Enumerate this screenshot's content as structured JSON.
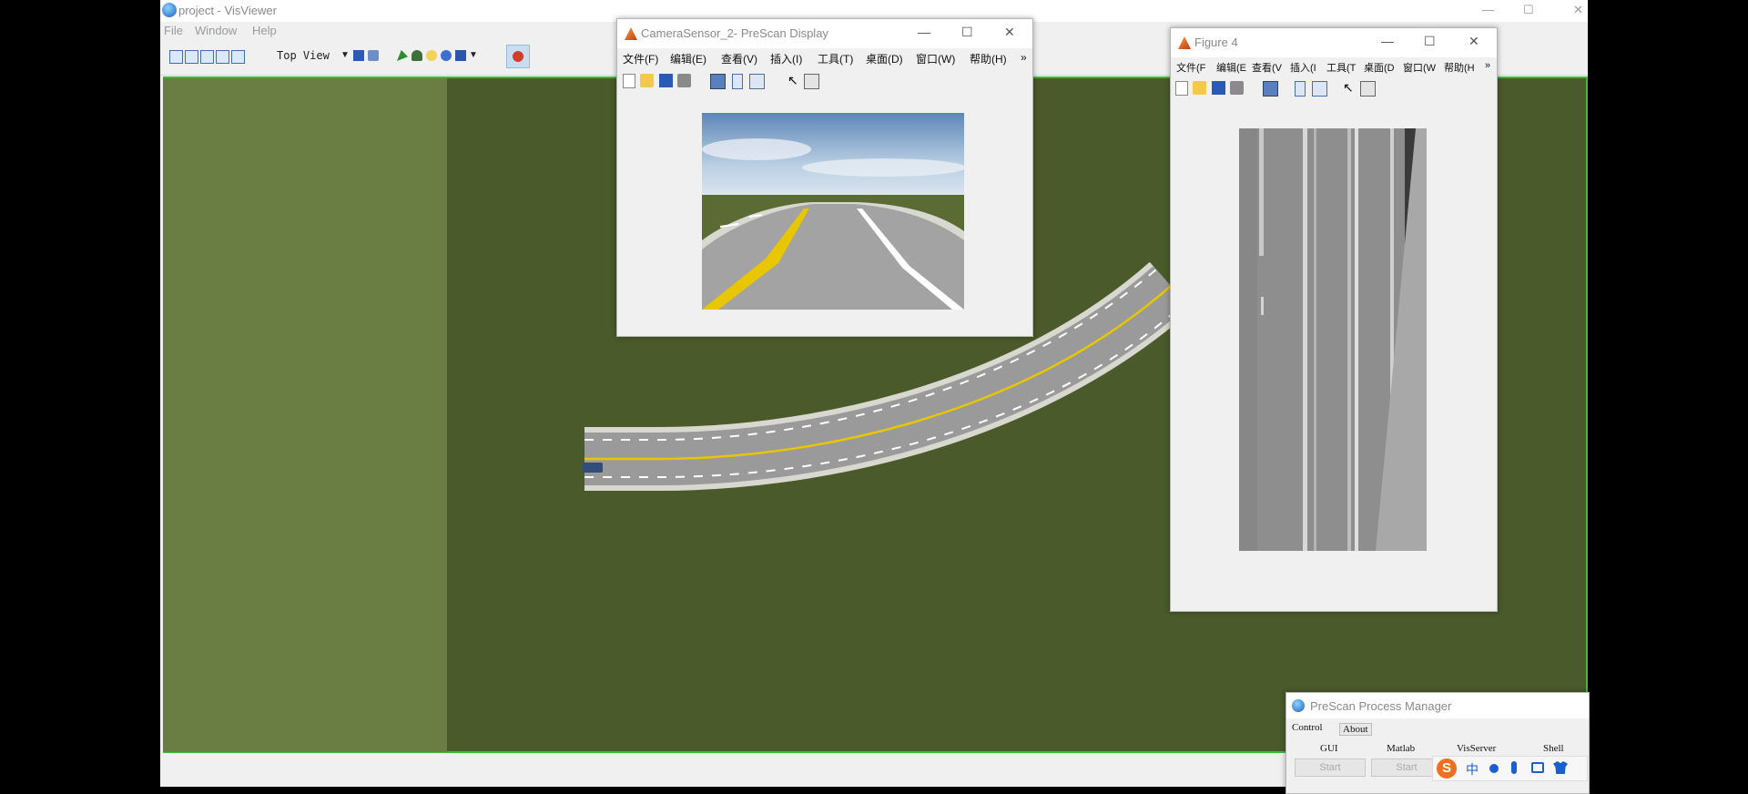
{
  "visviewer": {
    "title": "project - VisViewer",
    "menu": [
      "File",
      "Window",
      "Help"
    ],
    "view_mode": "Top View",
    "window_controls": [
      "—",
      "☐",
      "✕"
    ]
  },
  "camera_window": {
    "title": "CameraSensor_2- PreScan Display",
    "menu": [
      "文件(F)",
      "编辑(E)",
      "查看(V)",
      "插入(I)",
      "工具(T)",
      "桌面(D)",
      "窗口(W)",
      "帮助(H)"
    ],
    "overflow": "»",
    "controls": [
      "—",
      "☐",
      "✕"
    ]
  },
  "figure_window": {
    "title": "Figure 4",
    "menu": [
      "文件(F",
      "编辑(E",
      "查看(V",
      "插入(I",
      "工具(T",
      "桌面(D",
      "窗口(W",
      "帮助(H"
    ],
    "overflow": "»",
    "controls": [
      "—",
      "☐",
      "✕"
    ]
  },
  "process_manager": {
    "title": "PreScan Process Manager",
    "tabs": [
      "Control",
      "About"
    ],
    "columns": [
      "GUI",
      "Matlab",
      "VisServer",
      "Shell"
    ],
    "start_label": "Start"
  },
  "ime": {
    "mode": "中",
    "logo": "S",
    "icons": [
      "punctuation-icon",
      "microphone-icon",
      "keyboard-icon",
      "skin-icon"
    ]
  },
  "colors": {
    "scene_ground": "#4a5a2a",
    "scene_strip": "#6a7e43",
    "scene_border": "#3cba3c",
    "road_asphalt": "#9a9a9a",
    "road_edge": "#d8d8d0",
    "lane_yellow": "#e8c600"
  }
}
